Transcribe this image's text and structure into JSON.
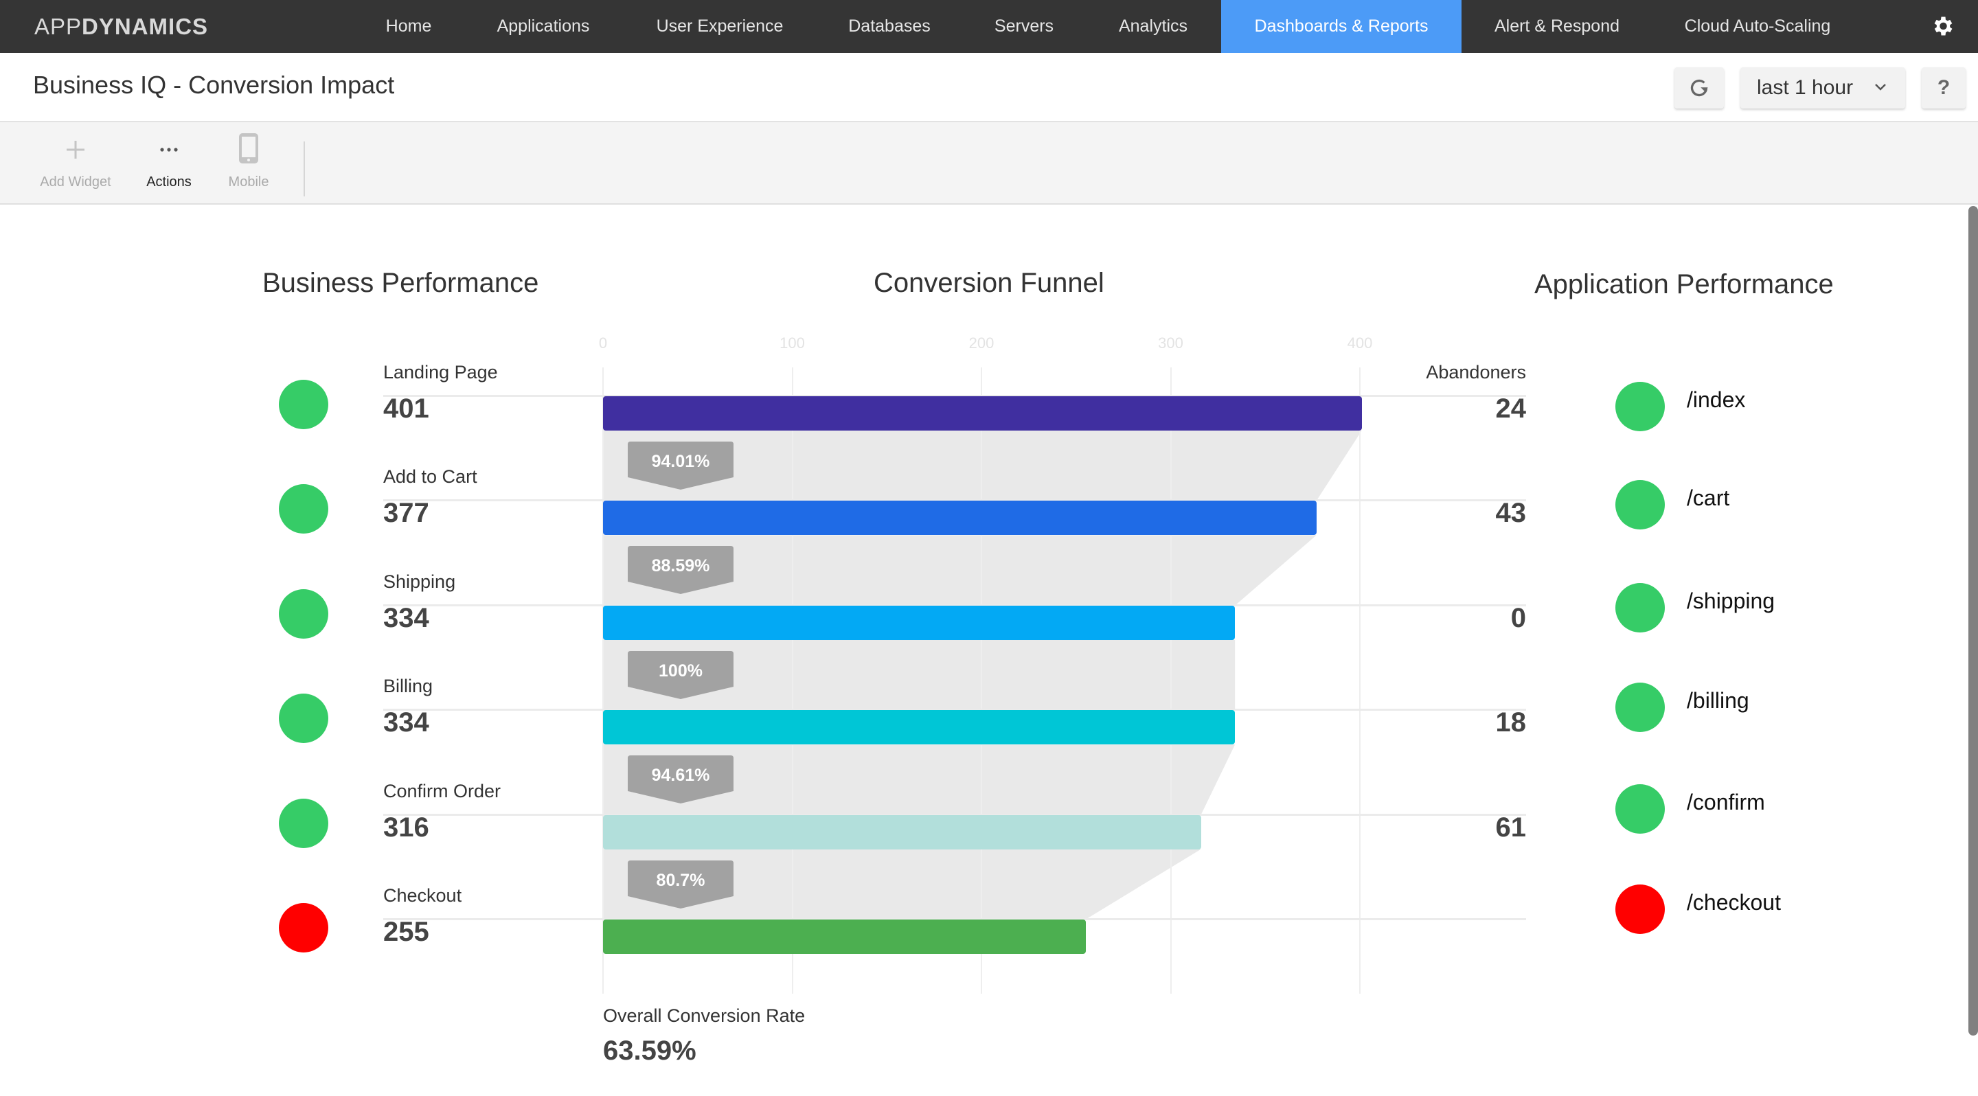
{
  "nav": {
    "logo_thin": "APP",
    "logo_bold": "DYNAMICS",
    "items": [
      {
        "label": "Home",
        "active": false
      },
      {
        "label": "Applications",
        "active": false
      },
      {
        "label": "User Experience",
        "active": false
      },
      {
        "label": "Databases",
        "active": false
      },
      {
        "label": "Servers",
        "active": false
      },
      {
        "label": "Analytics",
        "active": false
      },
      {
        "label": "Dashboards & Reports",
        "active": true
      },
      {
        "label": "Alert & Respond",
        "active": false
      },
      {
        "label": "Cloud Auto-Scaling",
        "active": false
      }
    ],
    "settings_icon": "gear-icon",
    "active_color": "#4c9bf7"
  },
  "header": {
    "title": "Business IQ - Conversion Impact",
    "refresh_icon": "refresh-icon",
    "time_range": "last 1 hour",
    "help_label": "?"
  },
  "toolbar": {
    "add_widget": "Add Widget",
    "actions": "Actions",
    "mobile": "Mobile"
  },
  "sections": {
    "business": "Business Performance",
    "funnel": "Conversion Funnel",
    "application": "Application Performance"
  },
  "funnel": {
    "abandoners_label": "Abandoners",
    "overall_label": "Overall Conversion Rate",
    "overall_value": "63.59%"
  },
  "status_colors": {
    "good": "#36cc67",
    "bad": "#ff0000"
  },
  "chart_data": {
    "type": "bar",
    "title": "Conversion Funnel",
    "orientation": "horizontal",
    "xlim": [
      0,
      400
    ],
    "xticks": [
      "0",
      "100",
      "200",
      "300",
      "400"
    ],
    "grid": true,
    "categories": [
      "Landing Page",
      "Add to Cart",
      "Shipping",
      "Billing",
      "Confirm Order",
      "Checkout"
    ],
    "values": [
      401,
      377,
      334,
      334,
      316,
      255
    ],
    "value_labels": [
      "401",
      "377",
      "334",
      "334",
      "316",
      "255"
    ],
    "bar_colors": [
      "#402fa0",
      "#1f6be6",
      "#03a9f4",
      "#00c6d6",
      "#b2dfdb",
      "#4caf50"
    ],
    "abandoners": [
      "24",
      "43",
      "0",
      "18",
      "61",
      ""
    ],
    "step_conversion": [
      "94.01%",
      "88.59%",
      "100%",
      "94.61%",
      "80.7%"
    ],
    "business_status": [
      "good",
      "good",
      "good",
      "good",
      "good",
      "bad"
    ]
  },
  "app_performance": [
    {
      "label": "/index",
      "status": "good"
    },
    {
      "label": "/cart",
      "status": "good"
    },
    {
      "label": "/shipping",
      "status": "good"
    },
    {
      "label": "/billing",
      "status": "good"
    },
    {
      "label": "/confirm",
      "status": "good"
    },
    {
      "label": "/checkout",
      "status": "bad"
    }
  ]
}
